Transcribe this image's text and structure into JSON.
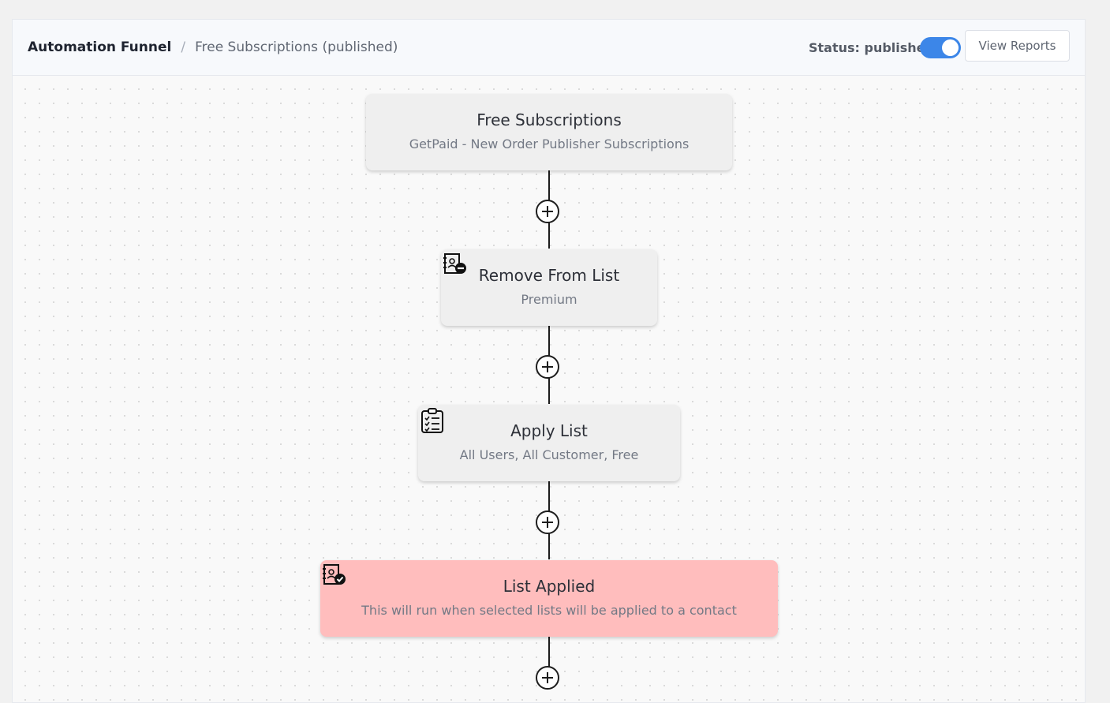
{
  "breadcrumb": {
    "root": "Automation Funnel",
    "separator": "/",
    "current": "Free Subscriptions (published)"
  },
  "header": {
    "status_label": "Status: published",
    "status_enabled": true,
    "view_reports_label": "View Reports"
  },
  "colors": {
    "accent": "#3c86e8",
    "node_bg": "#efefef",
    "trigger_bg": "#ffbdbd"
  },
  "funnel": {
    "nodes": [
      {
        "title": "Free Subscriptions",
        "subtitle": "GetPaid - New Order Publisher Subscriptions",
        "icon": "none"
      },
      {
        "title": "Remove From List",
        "subtitle": "Premium",
        "icon": "contact-list-remove-icon"
      },
      {
        "title": "Apply List",
        "subtitle": "All Users, All Customer, Free",
        "icon": "clipboard-checklist-icon"
      },
      {
        "title": "List Applied",
        "subtitle": "This will run when selected lists will be applied to a contact",
        "icon": "contact-list-check-icon"
      }
    ],
    "add_step_icon": "plus-circle-icon"
  }
}
